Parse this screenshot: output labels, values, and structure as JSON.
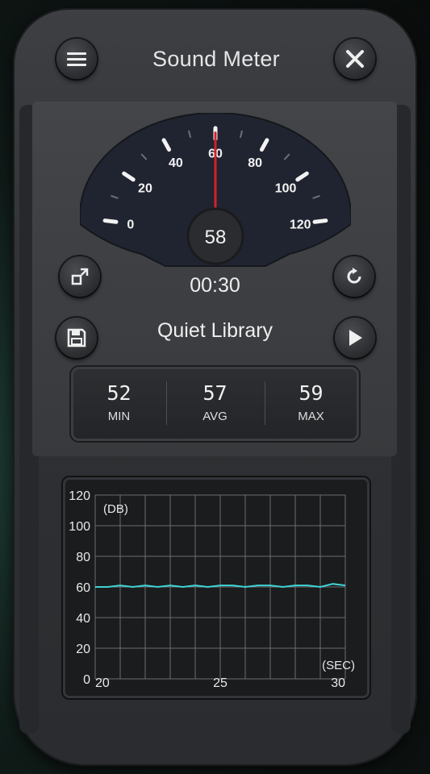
{
  "header": {
    "title": "Sound Meter"
  },
  "gauge": {
    "current_value": "58",
    "needle_value": 60,
    "range": [
      0,
      120
    ],
    "scale_labels": [
      "0",
      "20",
      "40",
      "60",
      "80",
      "100",
      "120"
    ]
  },
  "timer": "00:30",
  "preset_name": "Quiet Library",
  "stats": {
    "min_value": "52",
    "min_label": "MIN",
    "avg_value": "57",
    "avg_label": "AVG",
    "max_value": "59",
    "max_label": "MAX"
  },
  "chart_data": {
    "type": "line",
    "ylabel": "(DB)",
    "xlabel": "(SEC)",
    "ylim": [
      0,
      120
    ],
    "xlim": [
      20,
      30
    ],
    "y_ticks": [
      "120",
      "100",
      "80",
      "60",
      "40",
      "20",
      "0"
    ],
    "x_ticks": [
      "20",
      "25",
      "30"
    ],
    "grid": true,
    "series": [
      {
        "color": "#3fd3d6",
        "x": [
          20,
          20.5,
          21,
          21.5,
          22,
          22.5,
          23,
          23.5,
          24,
          24.5,
          25,
          25.5,
          26,
          26.5,
          27,
          27.5,
          28,
          28.5,
          29,
          29.5,
          30
        ],
        "y": [
          60,
          60,
          61,
          60,
          61,
          60,
          61,
          60,
          61,
          60,
          61,
          61,
          60,
          61,
          61,
          60,
          61,
          61,
          60,
          62,
          61
        ]
      }
    ]
  },
  "colors": {
    "accent": "#3fd3d6",
    "needle": "#d6202a"
  }
}
